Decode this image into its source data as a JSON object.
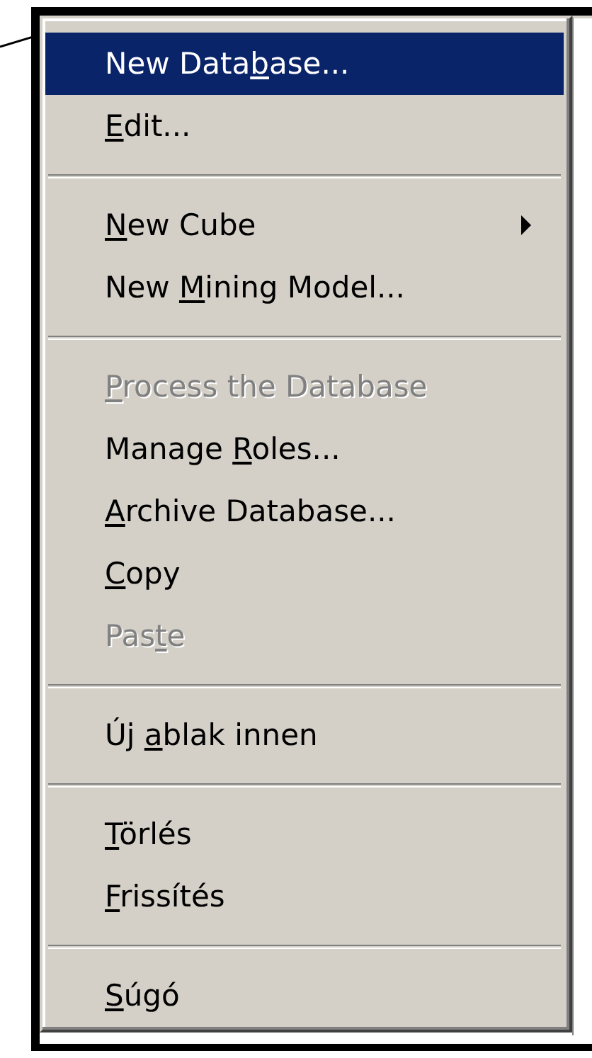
{
  "menu": {
    "items": [
      {
        "kind": "item",
        "pre": "New Data",
        "key": "b",
        "post": "ase...",
        "selected": true,
        "disabled": false,
        "submenu": false
      },
      {
        "kind": "item",
        "key": "E",
        "post": "dit...",
        "selected": false,
        "disabled": false,
        "submenu": false
      },
      {
        "kind": "separator"
      },
      {
        "kind": "item",
        "key": "N",
        "post": "ew Cube",
        "selected": false,
        "disabled": false,
        "submenu": true
      },
      {
        "kind": "item",
        "pre": "New ",
        "key": "M",
        "post": "ining Model...",
        "selected": false,
        "disabled": false,
        "submenu": false
      },
      {
        "kind": "separator"
      },
      {
        "kind": "item",
        "key": "P",
        "post": "rocess the Database",
        "selected": false,
        "disabled": true,
        "submenu": false
      },
      {
        "kind": "item",
        "pre": "Manage ",
        "key": "R",
        "post": "oles...",
        "selected": false,
        "disabled": false,
        "submenu": false
      },
      {
        "kind": "item",
        "key": "A",
        "post": "rchive Database...",
        "selected": false,
        "disabled": false,
        "submenu": false
      },
      {
        "kind": "item",
        "key": "C",
        "post": "opy",
        "selected": false,
        "disabled": false,
        "submenu": false
      },
      {
        "kind": "item",
        "pre": "Pas",
        "key": "t",
        "post": "e",
        "selected": false,
        "disabled": true,
        "submenu": false
      },
      {
        "kind": "separator"
      },
      {
        "kind": "item",
        "pre": "Új ",
        "key": "a",
        "post": "blak innen",
        "selected": false,
        "disabled": false,
        "submenu": false
      },
      {
        "kind": "separator"
      },
      {
        "kind": "item",
        "key": "T",
        "post": "örlés",
        "selected": false,
        "disabled": false,
        "submenu": false
      },
      {
        "kind": "item",
        "key": "F",
        "post": "rissítés",
        "selected": false,
        "disabled": false,
        "submenu": false
      },
      {
        "kind": "separator"
      },
      {
        "kind": "item",
        "key": "S",
        "post": "úgó",
        "selected": false,
        "disabled": false,
        "submenu": false
      }
    ]
  }
}
